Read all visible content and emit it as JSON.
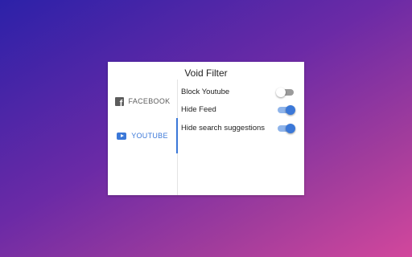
{
  "popup": {
    "title": "Void Filter"
  },
  "tabs": [
    {
      "label": "FACEBOOK",
      "icon": "facebook-icon",
      "selected": false
    },
    {
      "label": "YOUTUBE",
      "icon": "youtube-icon",
      "selected": true
    }
  ],
  "settings": [
    {
      "label": "Block Youtube",
      "enabled": false
    },
    {
      "label": "Hide Feed",
      "enabled": true
    },
    {
      "label": "Hide search suggestions",
      "enabled": true
    }
  ],
  "colors": {
    "accent": "#3b78d8",
    "toggle_track_on": "#8fb4ea",
    "toggle_track_off": "#9b9b9b",
    "background_gradient_start": "#2c21a8",
    "background_gradient_end": "#d2479c"
  }
}
